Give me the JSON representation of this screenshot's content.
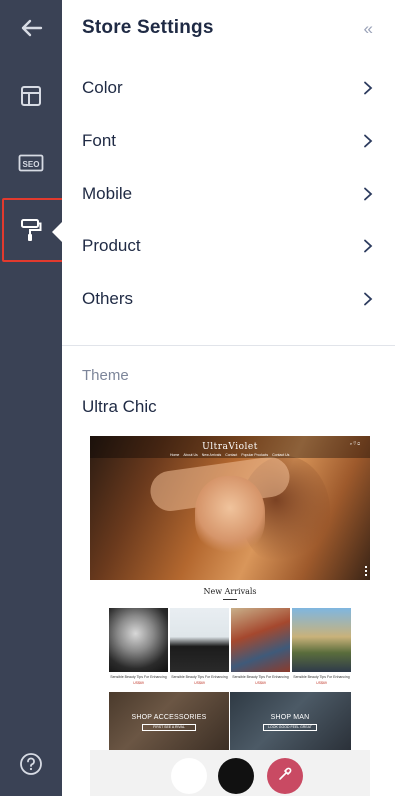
{
  "header": {
    "title": "Store Settings",
    "collapse_glyph": "«"
  },
  "rail": {
    "items": [
      {
        "icon": "back-arrow-icon"
      },
      {
        "icon": "layout-icon"
      },
      {
        "icon": "seo-icon",
        "label": "SEO"
      },
      {
        "icon": "paint-roller-icon",
        "active": true
      }
    ],
    "help_icon": "help-icon"
  },
  "menu": {
    "items": [
      {
        "label": "Color"
      },
      {
        "label": "Font"
      },
      {
        "label": "Mobile"
      },
      {
        "label": "Product"
      },
      {
        "label": "Others"
      }
    ]
  },
  "theme": {
    "section_label": "Theme",
    "name": "Ultra Chic",
    "preview": {
      "brand": "UltraViolet",
      "nav": [
        "Home",
        "About Us",
        "New Arrivals",
        "Contact",
        "Popular Products",
        "Contact Us"
      ],
      "icons_text": "⌕ ♡ ⊡",
      "section_title": "New Arrivals",
      "products": [
        {
          "name": "Sensible Beauty Tips For Enhancing",
          "price": "US$69"
        },
        {
          "name": "Sensible Beauty Tips For Enhancing",
          "price": "US$69"
        },
        {
          "name": "Sensible Beauty Tips For Enhancing",
          "price": "US$69"
        },
        {
          "name": "Sensible Beauty Tips For Enhancing",
          "price": "US$69"
        }
      ],
      "banners": [
        {
          "title": "SHOP ACCESSORIES",
          "button": "FIRST SEE A RIVAL"
        },
        {
          "title": "SHOP MAN",
          "button": "LOOK GOOD FEEL GREAT"
        }
      ]
    }
  },
  "palette": {
    "swatches": [
      {
        "color": "#ffffff"
      },
      {
        "color": "#111111"
      },
      {
        "color": "#c94a63",
        "icon": "eyedropper-icon"
      }
    ]
  },
  "colors": {
    "rail_bg": "#3a4255",
    "active_outline": "#e23a2e",
    "text": "#1f2a44",
    "muted": "#7d869a"
  }
}
